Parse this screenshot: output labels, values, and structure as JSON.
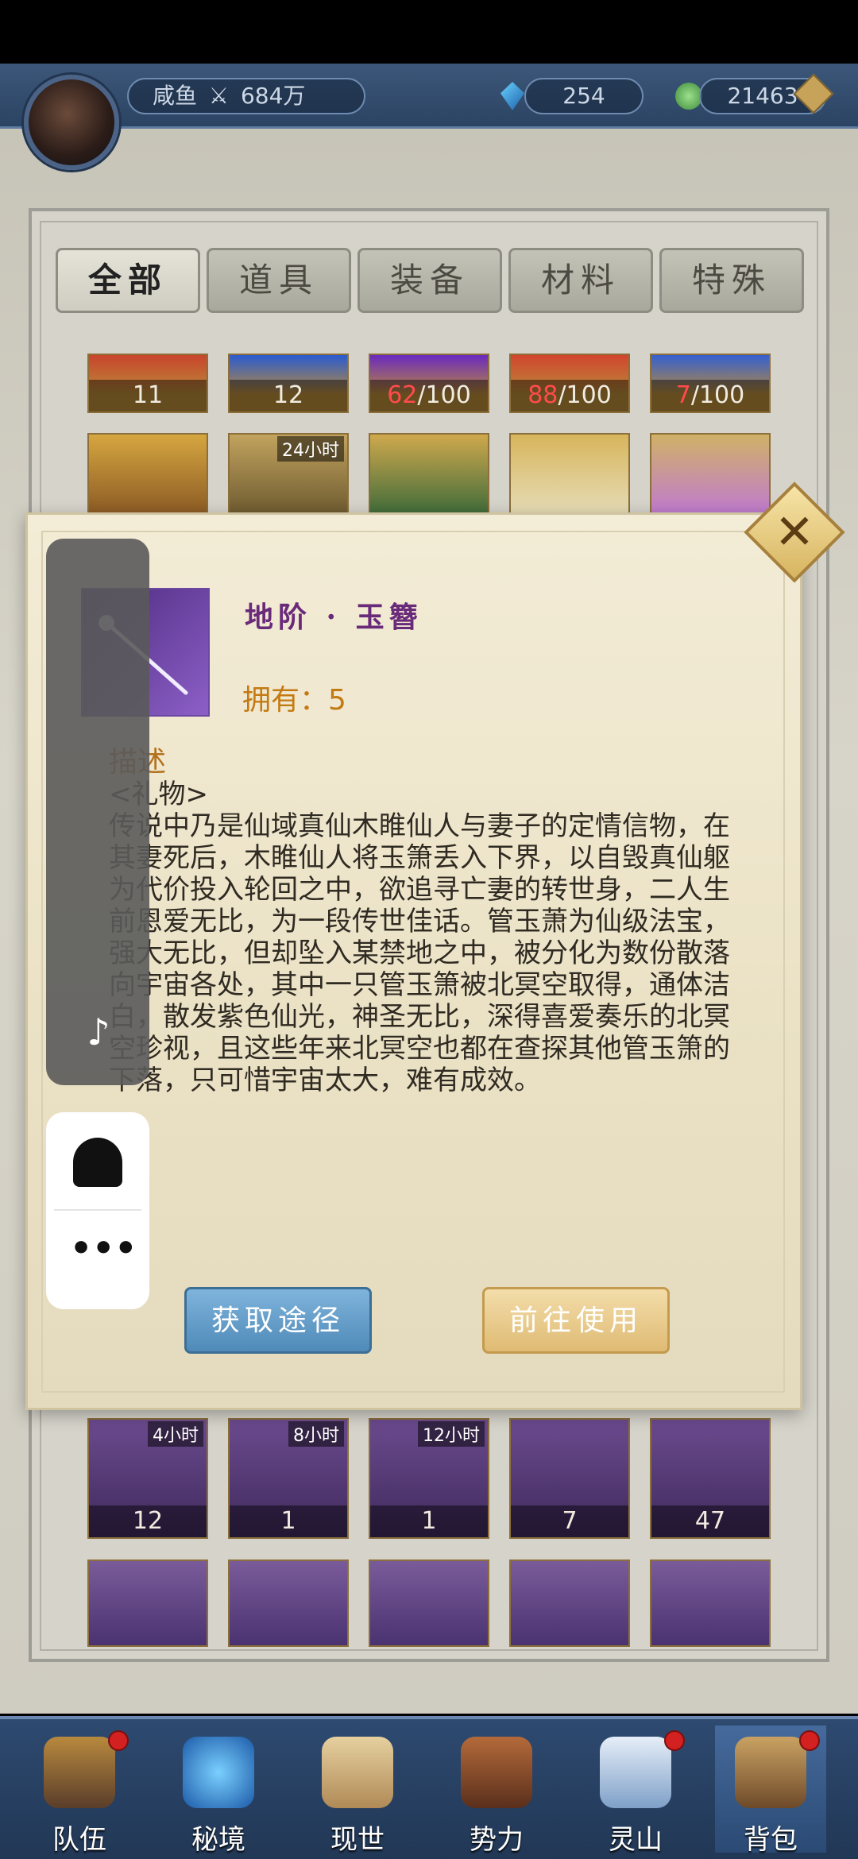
{
  "header": {
    "player_name": "咸鱼",
    "power": "684万",
    "gems": "254",
    "jade": "21463"
  },
  "tabs": [
    {
      "label": "全部",
      "active": true
    },
    {
      "label": "道具"
    },
    {
      "label": "装备"
    },
    {
      "label": "材料"
    },
    {
      "label": "特殊"
    }
  ],
  "grid_rows": {
    "row1_counts": [
      "11",
      "12"
    ],
    "row1_frac": [
      {
        "cur": "62",
        "max": "/100"
      },
      {
        "cur": "88",
        "max": "/100"
      },
      {
        "cur": "7",
        "max": "/100"
      }
    ],
    "row2_time": "24小时",
    "row3_times": [
      "4小时",
      "8小时",
      "12小时"
    ],
    "row3_counts": [
      "12",
      "1",
      "1",
      "7",
      "47"
    ]
  },
  "popup": {
    "item_name": "地阶 · 玉簪",
    "owned": "拥有：5",
    "desc_title": "描述",
    "desc_tag": "<礼物>",
    "desc_text": "传说中乃是仙域真仙木睢仙人与妻子的定情信物，在其妻死后，木睢仙人将玉箫丢入下界，以自毁真仙躯为代价投入轮回之中，欲追寻亡妻的转世身，二人生前恩爱无比，为一段传世佳话。管玉萧为仙级法宝，强大无比，但却坠入某禁地之中，被分化为数份散落向宇宙各处，其中一只管玉箫被北冥空取得，通体洁白，散发紫色仙光，神圣无比，深得喜爱奏乐的北冥空珍视，且这些年来北冥空也都在查探其他管玉箫的下落，只可惜宇宙太大，难有成效。",
    "get_label": "获取途径",
    "use_label": "前往使用",
    "close_glyph": "✕"
  },
  "nav": [
    {
      "label": "队伍",
      "dot": true
    },
    {
      "label": "秘境"
    },
    {
      "label": "现世"
    },
    {
      "label": "势力"
    },
    {
      "label": "灵山",
      "dot": true
    },
    {
      "label": "背包",
      "dot": true,
      "active": true
    }
  ]
}
